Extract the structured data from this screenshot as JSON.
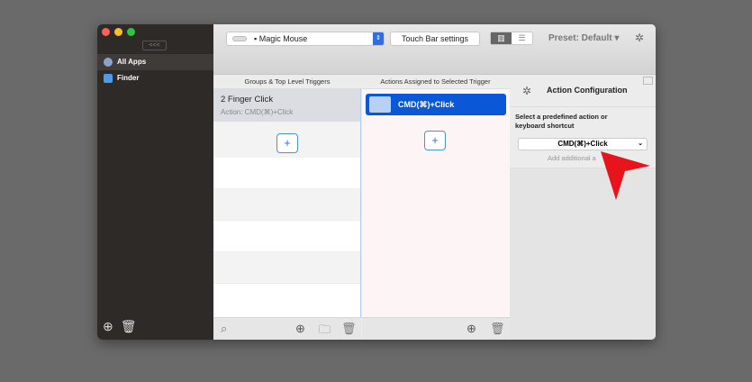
{
  "sidebar": {
    "collapse": "<<<",
    "items": [
      {
        "label": "All Apps",
        "icon": "globe-icon"
      },
      {
        "label": "Finder",
        "icon": "finder-icon"
      }
    ]
  },
  "toolbar": {
    "device": "▪ Magic Mouse",
    "touchbar": "Touch Bar settings",
    "preset": "Preset: Default ▾"
  },
  "groups": {
    "header": "Groups & Top Level Triggers",
    "trigger_title": "2 Finger Click",
    "trigger_action": "Action: CMD(⌘)+Click"
  },
  "actions": {
    "header": "Actions Assigned to Selected Trigger",
    "item": "CMD(⌘)+Click"
  },
  "config": {
    "title": "Action Configuration",
    "prompt": "Select a predefined action or keyboard shortcut",
    "selected": "CMD(⌘)+Click",
    "add_more": "Add additional a"
  },
  "colors": {
    "accent": "#0a58d8",
    "arrow": "#e8141b"
  }
}
